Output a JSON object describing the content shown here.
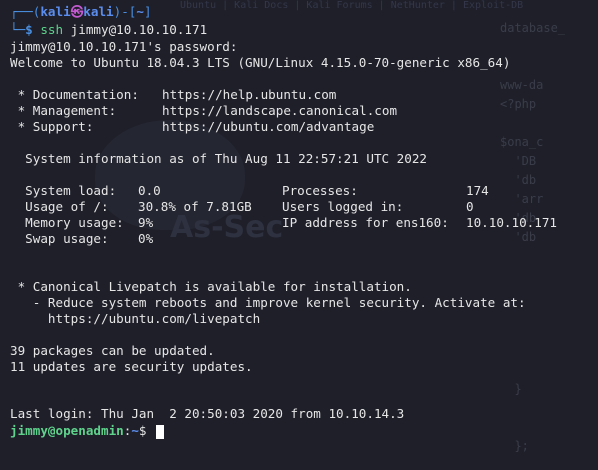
{
  "background": {
    "tabs_text": "Ubuntu   |   Kali Docs   |   Kali Forums   |   NetHunter   |   Exploit-DB",
    "code_lines": [
      "",
      "database_",
      "",
      "",
      "www-da",
      "<?php",
      "",
      "$ona_c",
      "  'DB",
      "  'db",
      "  'arr",
      "  'db",
      "  'db",
      "",
      "",
      "",
      "",
      "",
      "",
      "",
      "  }",
      "",
      "",
      "  };"
    ],
    "watermark": "As-Sec"
  },
  "terminal": {
    "header": {
      "frame_top": "┌──(",
      "user": "kali",
      "skull": "㉿",
      "host": "kali",
      "mid": ")-[",
      "dir": "~",
      "end": "]",
      "frame_bottom": "└─",
      "dollar": "$ ",
      "command": "ssh",
      "args": " jimmy@10.10.10.171"
    },
    "password_prompt": "jimmy@10.10.10.171's password:",
    "welcome": "Welcome to Ubuntu 18.04.3 LTS (GNU/Linux 4.15.0-70-generic x86_64)",
    "links": [
      {
        "label": " * Documentation:",
        "url": "https://help.ubuntu.com"
      },
      {
        "label": " * Management:",
        "url": "https://landscape.canonical.com"
      },
      {
        "label": " * Support:",
        "url": "https://ubuntu.com/advantage"
      }
    ],
    "sysinfo_heading": "  System information as of Thu Aug 11 22:57:21 UTC 2022",
    "stats": [
      {
        "l_label": "  System load:",
        "l_value": "0.0",
        "r_label": "Processes:",
        "r_value": "174"
      },
      {
        "l_label": "  Usage of /:",
        "l_value": "30.8% of 7.81GB",
        "r_label": "Users logged in:",
        "r_value": "0"
      },
      {
        "l_label": "  Memory usage:",
        "l_value": "9%",
        "r_label": "IP address for ens160:",
        "r_value": "10.10.10.171"
      },
      {
        "l_label": "  Swap usage:",
        "l_value": "0%",
        "r_label": "",
        "r_value": ""
      }
    ],
    "livepatch": [
      " * Canonical Livepatch is available for installation.",
      "   - Reduce system reboots and improve kernel security. Activate at:",
      "     https://ubuntu.com/livepatch"
    ],
    "updates": [
      "39 packages can be updated.",
      "11 updates are security updates."
    ],
    "last_login": "Last login: Thu Jan  2 20:50:03 2020 from 10.10.14.3",
    "shell_prompt": {
      "user_host": "jimmy@openadmin",
      "sep": ":",
      "path": "~",
      "dollar": "$ "
    }
  }
}
